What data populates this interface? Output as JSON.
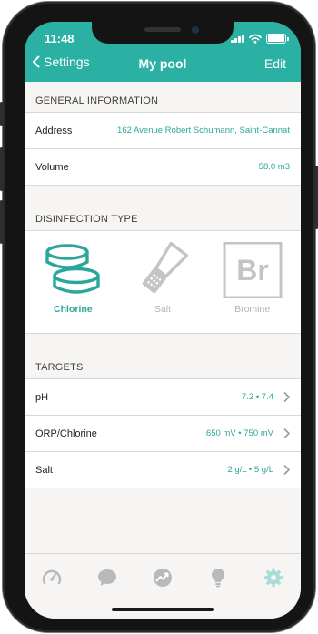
{
  "status": {
    "time": "11:48"
  },
  "nav": {
    "back_label": "Settings",
    "title": "My pool",
    "edit_label": "Edit"
  },
  "general": {
    "header": "GENERAL INFORMATION",
    "rows": [
      {
        "label": "Address",
        "value": "162 Avenue Robert Schumann, Saint-Cannat"
      },
      {
        "label": "Volume",
        "value": "58.0 m3"
      }
    ]
  },
  "disinfection": {
    "header": "DISINFECTION TYPE",
    "options": [
      {
        "label": "Chlorine",
        "selected": true
      },
      {
        "label": "Salt",
        "selected": false
      },
      {
        "label": "Bromine",
        "selected": false,
        "symbol": "Br"
      }
    ]
  },
  "targets": {
    "header": "TARGETS",
    "rows": [
      {
        "label": "pH",
        "value": "7.2 • 7.4"
      },
      {
        "label": "ORP/Chlorine",
        "value": "650 mV • 750 mV"
      },
      {
        "label": "Salt",
        "value": "2 g/L • 5 g/L"
      }
    ]
  },
  "tabbar": {
    "items": [
      {
        "icon": "gauge-icon",
        "active": false
      },
      {
        "icon": "chat-bubble-icon",
        "active": false
      },
      {
        "icon": "trend-chart-icon",
        "active": false
      },
      {
        "icon": "lightbulb-icon",
        "active": false
      },
      {
        "icon": "gear-icon",
        "active": true
      }
    ]
  },
  "colors": {
    "accent": "#2ab1a4",
    "inactive_icon": "#b9b9b9",
    "background": "#f7f5f3"
  }
}
